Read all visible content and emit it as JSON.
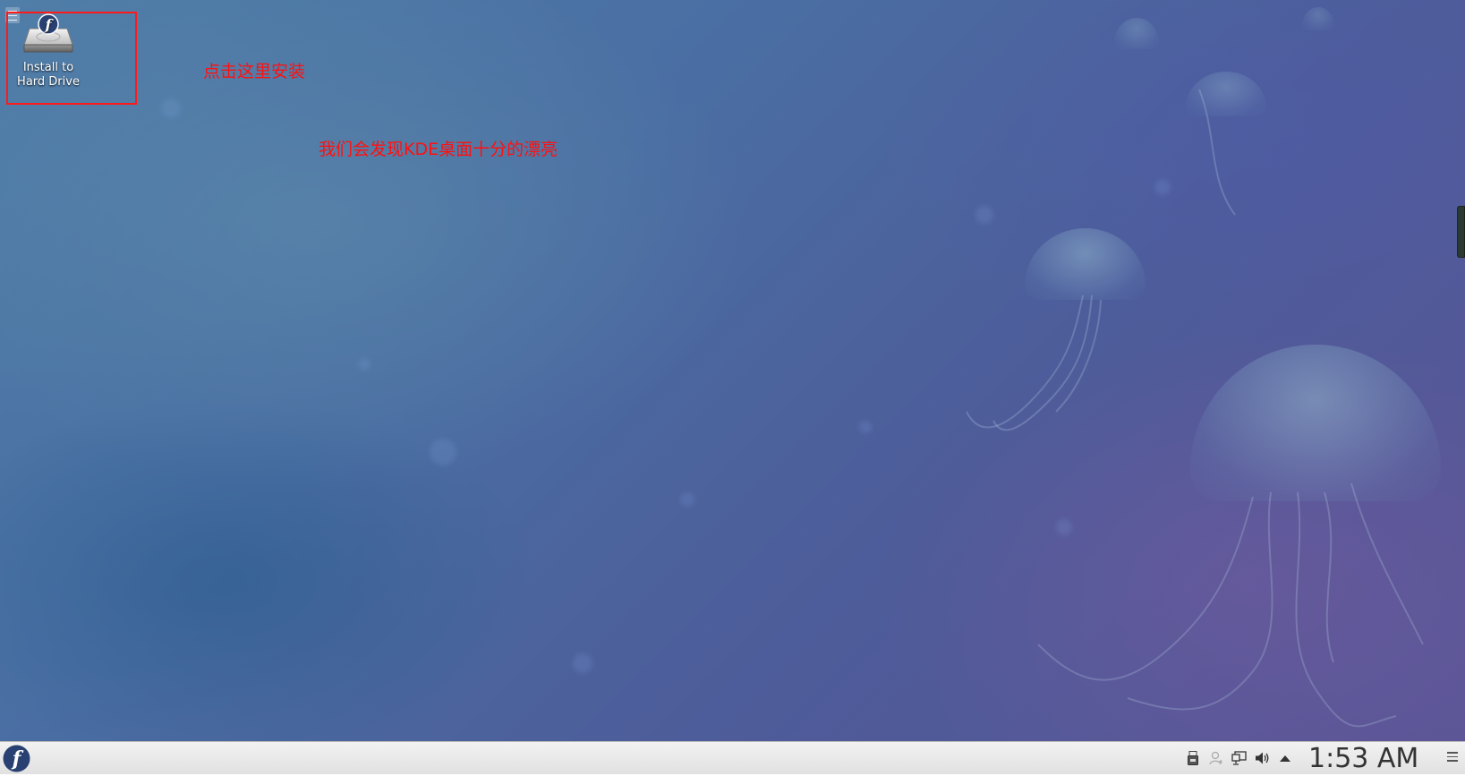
{
  "desktop": {
    "icons": [
      {
        "label_line1": "Install to",
        "label_line2": "Hard Drive"
      }
    ],
    "annotations": {
      "click_here": "点击这里安装",
      "kde_note": "我们会发现KDE桌面十分的漂亮"
    },
    "highlight_color": "#ff1a1a"
  },
  "taskbar": {
    "clock": "1:53 AM",
    "tray_icons": [
      "usb-drive-icon",
      "user-status-icon",
      "network-icon",
      "volume-icon",
      "expand-tray-icon"
    ]
  }
}
